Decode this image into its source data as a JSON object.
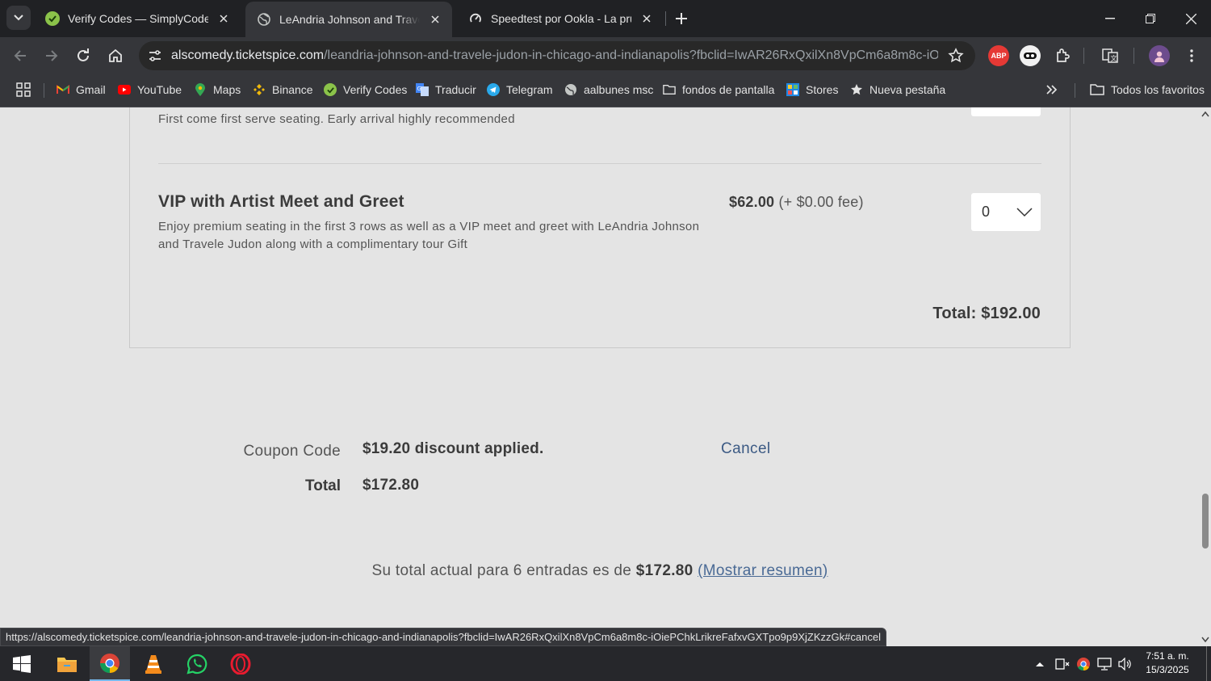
{
  "browser": {
    "tabs": [
      {
        "title": "Verify Codes — SimplyCodes",
        "icon": "simplycodes-icon",
        "active": false
      },
      {
        "title": "LeAndria Johnson and Travele Judon in Chicago and Indianapolis",
        "icon": "globe-icon",
        "active": true
      },
      {
        "title": "Speedtest por Ookla - La prueba de velocidad",
        "icon": "speedtest-icon",
        "active": false
      }
    ],
    "url_host": "alscomedy.ticketspice.com",
    "url_path": "/leandria-johnson-and-travele-judon-in-chicago-and-indianapolis?fbclid=IwAR26RxQxilXn8VpCm6a8m8c-iOieP...",
    "bookmarks": [
      {
        "label": "Gmail",
        "icon": "gmail-icon"
      },
      {
        "label": "YouTube",
        "icon": "youtube-icon"
      },
      {
        "label": "Maps",
        "icon": "maps-icon"
      },
      {
        "label": "Binance",
        "icon": "binance-icon"
      },
      {
        "label": "Verify Codes",
        "icon": "simplycodes-icon"
      },
      {
        "label": "Traducir",
        "icon": "translate-icon"
      },
      {
        "label": "Telegram",
        "icon": "telegram-icon"
      },
      {
        "label": "aalbunes msc",
        "icon": "globe-icon"
      },
      {
        "label": "fondos de pantalla",
        "icon": "folder-icon"
      },
      {
        "label": "Stores",
        "icon": "stores-icon"
      },
      {
        "label": "Nueva pestaña",
        "icon": "star-icon"
      }
    ],
    "all_bookmarks_label": "Todos los favoritos",
    "status_url": "https://alscomedy.ticketspice.com/leandria-johnson-and-travele-judon-in-chicago-and-indianapolis?fbclid=IwAR26RxQxilXn8VpCm6a8m8c-iOiePChkLrikreFafxvGXTpo9p9XjZKzzGk#cancel"
  },
  "page": {
    "previous_ticket_note": "First come first serve seating. Early arrival highly recommended",
    "ticket": {
      "name": "VIP with Artist Meet and Greet",
      "description": "Enjoy premium seating in the first 3 rows as well as a VIP meet and greet with LeAndria Johnson and Travele Judon along with a complimentary tour Gift",
      "price": "$62.00",
      "fee": "(+ $0.00 fee)",
      "quantity": "0"
    },
    "subtotal": "Total: $192.00",
    "coupon": {
      "label": "Coupon Code",
      "message": "$19.20 discount applied.",
      "cancel_label": "Cancel"
    },
    "total": {
      "label": "Total",
      "value": "$172.80"
    },
    "summary": {
      "prefix": "Su total actual para 6 entradas es de",
      "amount": "$172.80",
      "link": "(Mostrar resumen)"
    }
  },
  "taskbar": {
    "time": "7:51 a. m.",
    "date": "15/3/2025"
  },
  "colors": {
    "page_bg": "#e4e4e4",
    "link": "#3c5a84",
    "chrome_dark": "#202124",
    "chrome_toolbar": "#35363a"
  }
}
